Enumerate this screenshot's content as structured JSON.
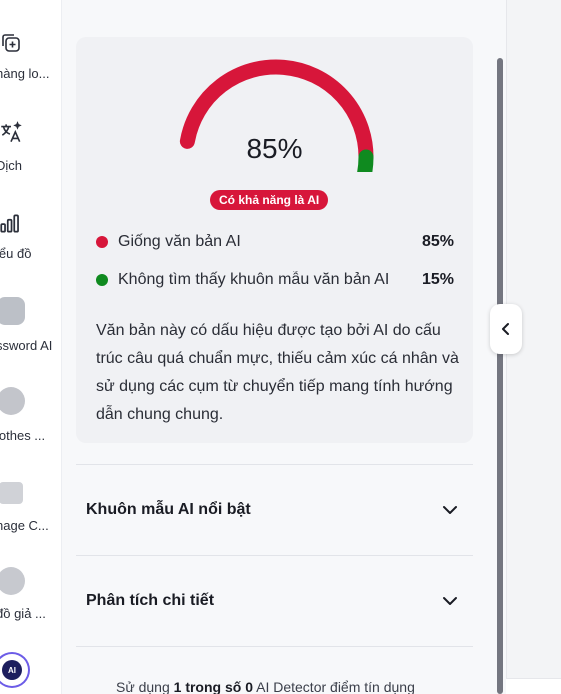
{
  "sidebar": {
    "items": [
      {
        "label": "hàng lo...",
        "icon": "add-copy-icon"
      },
      {
        "label": "Dịch",
        "icon": "translate-icon"
      },
      {
        "label": "iểu đồ",
        "icon": "chart-icon"
      },
      {
        "label": "ssword AI",
        "icon": "password-ai-thumb"
      },
      {
        "label": "lothes ...",
        "icon": "clothes-thumb"
      },
      {
        "label": "nage C...",
        "icon": "image-thumb"
      },
      {
        "label": "đồ giả ...",
        "icon": "map-thumb"
      }
    ],
    "ai_button_label": "AI"
  },
  "result": {
    "percentage": "85%",
    "ai_fraction": 0.85,
    "badge": "Có khả năng là AI",
    "stats": [
      {
        "label": "Giống văn bản AI",
        "value": "85%",
        "color": "#d7163a"
      },
      {
        "label": "Không tìm thấy khuôn mẫu văn bản AI",
        "value": "15%",
        "color": "#0f8a1f"
      }
    ],
    "explanation": "Văn bản này có dấu hiệu được tạo bởi AI do cấu trúc câu quá chuẩn mực, thiếu cảm xúc cá nhân và sử dụng các cụm từ chuyển tiếp mang tính hướng dẫn chung chung."
  },
  "accordions": [
    {
      "title": "Khuôn mẫu AI nổi bật"
    },
    {
      "title": "Phân tích chi tiết"
    }
  ],
  "footer": {
    "prefix": "Sử dụng ",
    "used": "1 trong số 0",
    "suffix": " AI Detector điểm tín dụng"
  },
  "colors": {
    "ai": "#d7163a",
    "human": "#0f8a1f"
  }
}
